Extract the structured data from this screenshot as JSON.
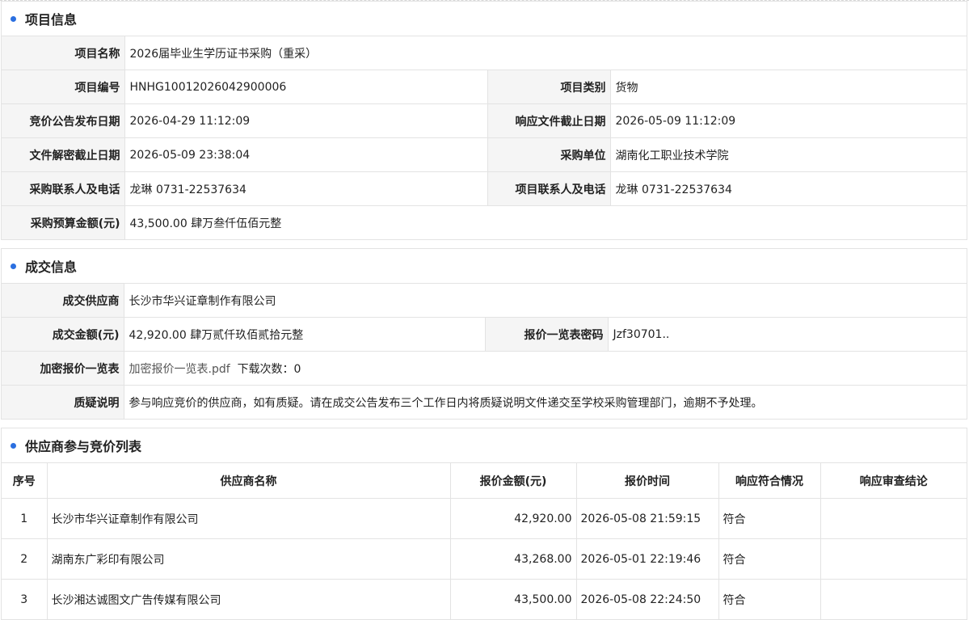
{
  "project_info": {
    "title": "项目信息",
    "name_label": "项目名称",
    "name_value": "2026届毕业生学历证书采购（重采）",
    "code_label": "项目编号",
    "code_value": "HNHG10012026042900006",
    "category_label": "项目类别",
    "category_value": "货物",
    "publish_date_label": "竞价公告发布日期",
    "publish_date_value": "2026-04-29 11:12:09",
    "response_deadline_label": "响应文件截止日期",
    "response_deadline_value": "2026-05-09 11:12:09",
    "decrypt_deadline_label": "文件解密截止日期",
    "decrypt_deadline_value": "2026-05-09 23:38:04",
    "purchaser_label": "采购单位",
    "purchaser_value": "湖南化工职业技术学院",
    "purchase_contact_label": "采购联系人及电话",
    "purchase_contact_value": "龙琳 0731-22537634",
    "project_contact_label": "项目联系人及电话",
    "project_contact_value": "龙琳 0731-22537634",
    "budget_label": "采购预算金额(元)",
    "budget_value": "43,500.00 肆万叁仟伍佰元整"
  },
  "deal_info": {
    "title": "成交信息",
    "supplier_label": "成交供应商",
    "supplier_value": "长沙市华兴证章制作有限公司",
    "amount_label": "成交金额(元)",
    "amount_value": "42,920.00 肆万贰仟玖佰贰拾元整",
    "password_label": "报价一览表密码",
    "password_value": "Jzf30701..",
    "encrypted_label": "加密报价一览表",
    "encrypted_file": "加密报价一览表.pdf",
    "download_count": "下载次数：0",
    "objection_label": "质疑说明",
    "objection_value": "参与响应竞价的供应商，如有质疑。请在成交公告发布三个工作日内将质疑说明文件递交至学校采购管理部门，逾期不予处理。"
  },
  "bid_list": {
    "title": "供应商参与竞价列表",
    "columns": [
      "序号",
      "供应商名称",
      "报价金额(元)",
      "报价时间",
      "响应符合情况",
      "响应审查结论"
    ],
    "rows": [
      {
        "no": "1",
        "supplier": "长沙市华兴证章制作有限公司",
        "amount": "42,920.00",
        "time": "2026-05-08 21:59:15",
        "compliance": "符合",
        "conclusion": ""
      },
      {
        "no": "2",
        "supplier": "湖南东广彩印有限公司",
        "amount": "43,268.00",
        "time": "2026-05-01 22:19:46",
        "compliance": "符合",
        "conclusion": ""
      },
      {
        "no": "3",
        "supplier": "长沙湘达诚图文广告传媒有限公司",
        "amount": "43,500.00",
        "time": "2026-05-08 22:24:50",
        "compliance": "符合",
        "conclusion": ""
      }
    ]
  },
  "colors": {
    "accent": "#2b6fe0",
    "label_bg": "#f5f5f5",
    "border": "#e3e3e3"
  }
}
